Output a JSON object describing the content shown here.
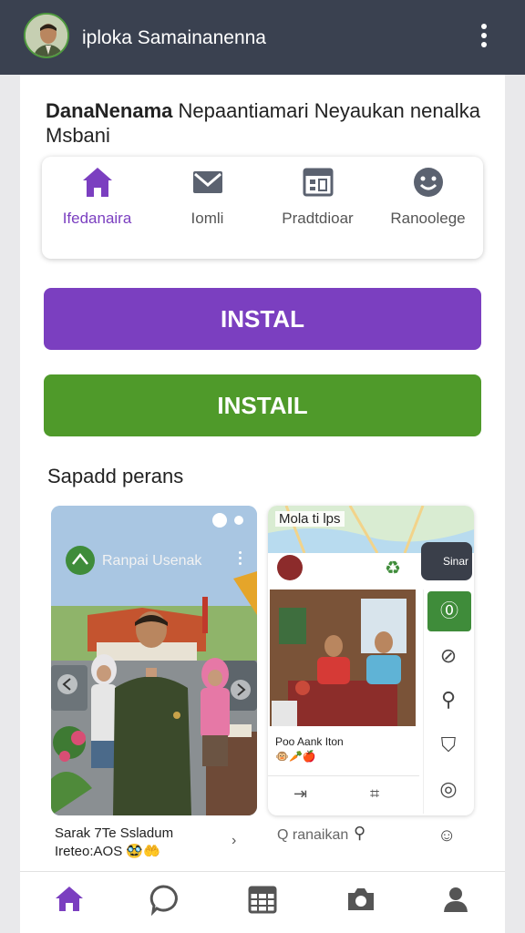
{
  "header": {
    "app_title": "iploka Samainanenna",
    "avatar_icon": "profile-photo",
    "menu_icon": "kebab-menu-icon"
  },
  "intro": {
    "bold": "DanaNenama",
    "rest": " Nepaantiamari Neyaukan nenalka Msbani"
  },
  "quick_nav": [
    {
      "label": "Ifedanaira",
      "icon": "home-icon",
      "active": true
    },
    {
      "label": "Iomli",
      "icon": "mail-icon",
      "active": false
    },
    {
      "label": "Pradtdioar",
      "icon": "calendar-icon",
      "active": false
    },
    {
      "label": "Ranoolege",
      "icon": "smiley-icon",
      "active": false
    }
  ],
  "buttons": {
    "primary_label": "INSTAL",
    "secondary_label": "INSTAIL"
  },
  "colors": {
    "accent_purple": "#7b3fc0",
    "accent_green": "#4f9a2a",
    "topbar": "#3a4150"
  },
  "section": {
    "title": "Sapadd perans"
  },
  "feed": {
    "post_author": "Ranpai Usenak",
    "caption_line1": "Sarak 7Te Ssladum",
    "caption_line2": "Ireteo:AOS",
    "caption_badges": "🥸🤲"
  },
  "side": {
    "map_label": "Mola ti lps",
    "map_chip": "Sinar",
    "photo_title": "Poo Aank Iton",
    "photo_badges": "🐵🥕🍎",
    "search_placeholder": "Q ranaikan"
  },
  "bottom_nav": [
    {
      "name": "home",
      "icon": "home-icon"
    },
    {
      "name": "chat",
      "icon": "chat-bubble-icon"
    },
    {
      "name": "calendar",
      "icon": "calendar-icon"
    },
    {
      "name": "camera",
      "icon": "camera-icon"
    },
    {
      "name": "profile",
      "icon": "profile-icon"
    }
  ]
}
